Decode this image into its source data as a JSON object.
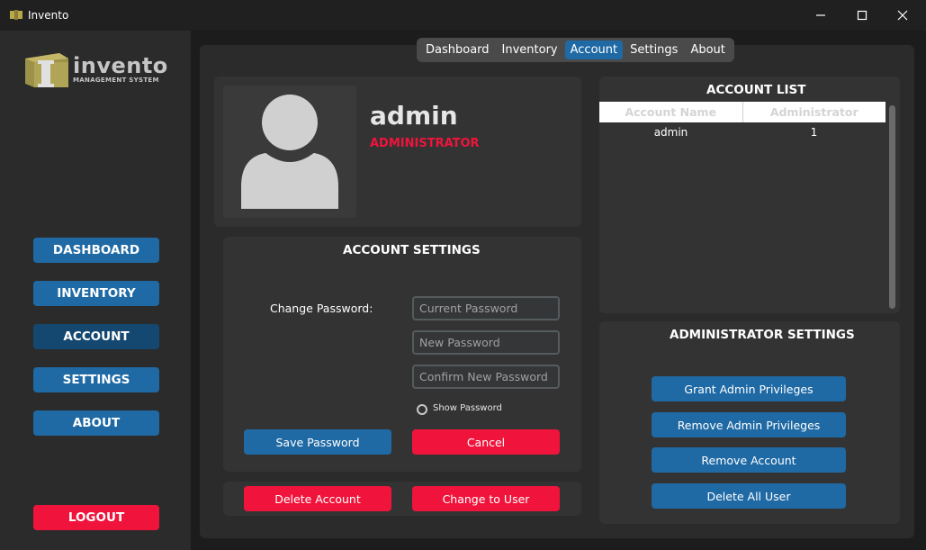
{
  "window": {
    "title": "Invento"
  },
  "logo": {
    "word": "invento",
    "subtitle": "MANAGEMENT SYSTEM"
  },
  "sidebar": {
    "items": [
      {
        "label": "DASHBOARD"
      },
      {
        "label": "INVENTORY"
      },
      {
        "label": "ACCOUNT"
      },
      {
        "label": "SETTINGS"
      },
      {
        "label": "ABOUT"
      }
    ],
    "active": "ACCOUNT",
    "logout_label": "LOGOUT"
  },
  "tabs": {
    "items": [
      {
        "label": "Dashboard"
      },
      {
        "label": "Inventory"
      },
      {
        "label": "Account"
      },
      {
        "label": "Settings"
      },
      {
        "label": "About"
      }
    ],
    "active": "Account"
  },
  "profile": {
    "username": "admin",
    "role": "ADMINISTRATOR"
  },
  "account_settings": {
    "title": "ACCOUNT SETTINGS",
    "change_password_label": "Change Password:",
    "current_password_placeholder": "Current Password",
    "new_password_placeholder": "New Password",
    "confirm_password_placeholder": "Confirm New Password",
    "show_password_label": "Show Password",
    "save_label": "Save Password",
    "cancel_label": "Cancel"
  },
  "account_actions": {
    "delete_label": "Delete Account",
    "change_label": "Change to User"
  },
  "account_list": {
    "title": "ACCOUNT LIST",
    "columns": [
      "Account Name",
      "Administrator"
    ],
    "rows": [
      [
        "admin",
        "1"
      ]
    ]
  },
  "admin_settings": {
    "title": "ADMINISTRATOR SETTINGS",
    "grant_label": "Grant Admin Privileges",
    "remove_priv_label": "Remove Admin Privileges",
    "remove_account_label": "Remove Account",
    "delete_all_label": "Delete All User"
  },
  "colors": {
    "accent": "#1f6aa5",
    "accent_active": "#144870",
    "danger": "#f0143c"
  }
}
